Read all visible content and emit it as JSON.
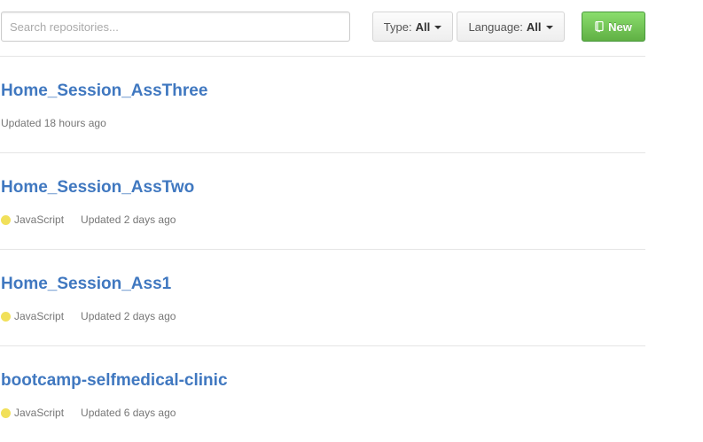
{
  "search": {
    "placeholder": "Search repositories..."
  },
  "filters": {
    "type": {
      "prefix": "Type:",
      "value": "All"
    },
    "language": {
      "prefix": "Language:",
      "value": "All"
    }
  },
  "new_button": {
    "label": "New",
    "icon": "repo-icon"
  },
  "colors": {
    "link": "#4078c0",
    "javascript": "#f1e05a",
    "new_button": "#60b044"
  },
  "repositories": [
    {
      "name": "Home_Session_AssThree",
      "language": "",
      "updated": "Updated 18 hours ago"
    },
    {
      "name": "Home_Session_AssTwo",
      "language": "JavaScript",
      "updated": "Updated 2 days ago"
    },
    {
      "name": "Home_Session_Ass1",
      "language": "JavaScript",
      "updated": "Updated 2 days ago"
    },
    {
      "name": "bootcamp-selfmedical-clinic",
      "language": "JavaScript",
      "updated": "Updated 6 days ago"
    }
  ]
}
